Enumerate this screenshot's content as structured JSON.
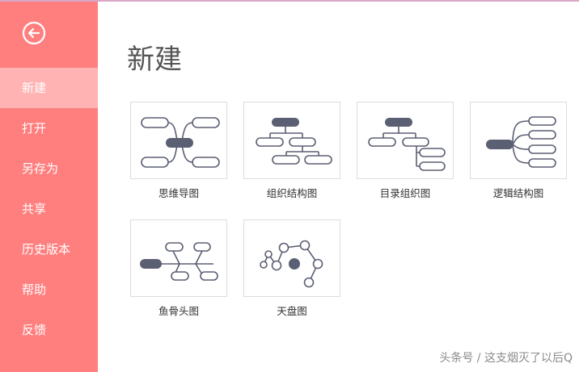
{
  "sidebar": {
    "back_icon": "back-arrow-icon",
    "items": [
      {
        "label": "新建",
        "active": true
      },
      {
        "label": "打开"
      },
      {
        "label": "另存为"
      },
      {
        "label": "共享"
      },
      {
        "label": "历史版本"
      },
      {
        "label": "帮助"
      },
      {
        "label": "反馈"
      }
    ]
  },
  "main": {
    "title": "新建",
    "templates": [
      {
        "label": "思维导图",
        "icon": "mind-map-icon"
      },
      {
        "label": "组织结构图",
        "icon": "org-chart-icon"
      },
      {
        "label": "目录组织图",
        "icon": "tree-chart-icon"
      },
      {
        "label": "逻辑结构图",
        "icon": "logic-chart-icon"
      },
      {
        "label": "鱼骨头图",
        "icon": "fishbone-icon"
      },
      {
        "label": "天盘图",
        "icon": "bubble-map-icon"
      }
    ]
  },
  "watermark": "头条号 / 这支烟灭了以后Q",
  "colors": {
    "sidebar": "#ff7f7f",
    "active_item": "#ffb3b3",
    "diagram": "#5b5f73"
  }
}
